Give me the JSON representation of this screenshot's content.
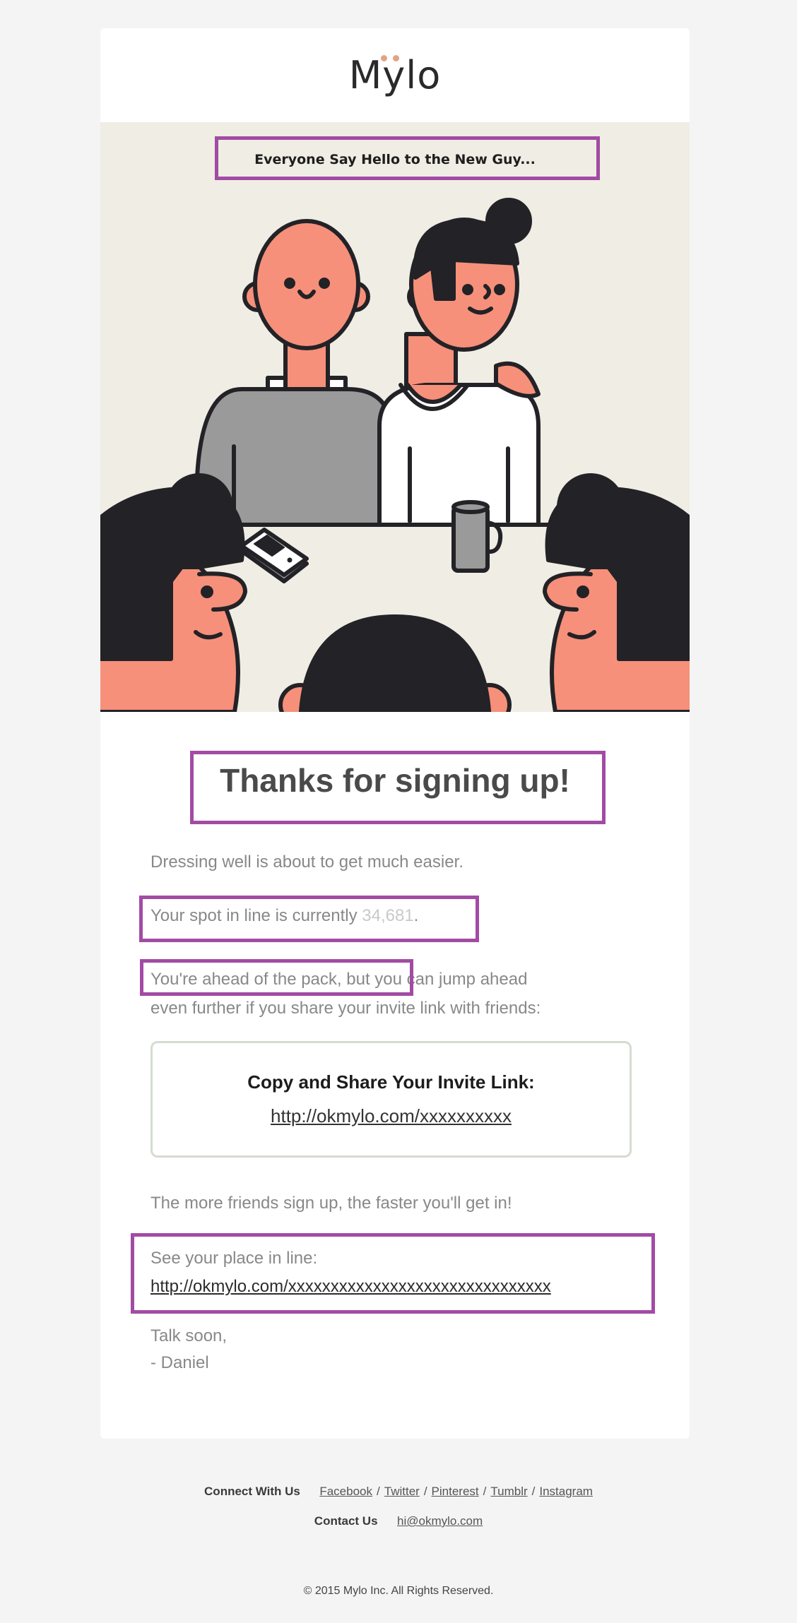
{
  "header": {
    "logo_text": "Mylo"
  },
  "hero": {
    "caption": "Everyone Say Hello to the New Guy...",
    "illustration": "team-meeting-illustration"
  },
  "main": {
    "title": "Thanks for signing up!",
    "intro": "Dressing well is about to get much easier.",
    "spot_prefix": "Your spot in line is currently ",
    "spot_number": "34,681",
    "spot_suffix": ".",
    "ahead_line1": "You're ahead of the pack, but you can jump ahead",
    "ahead_line2": "even further if you share your invite link with friends:",
    "invite_box": {
      "title": "Copy and Share Your Invite Link:",
      "link": "http://okmylo.com/xxxxxxxxxx"
    },
    "more_friends": "The more friends sign up, the faster you'll get in!",
    "place_label": "See your place in line:",
    "place_link": "http://okmylo.com/xxxxxxxxxxxxxxxxxxxxxxxxxxxxxxx",
    "signoff_1": "Talk soon,",
    "signoff_2": "- Daniel"
  },
  "footer": {
    "connect_label": "Connect With Us",
    "social_links": [
      "Facebook",
      "Twitter",
      "Pinterest",
      "Tumblr",
      "Instagram"
    ],
    "separator": "/",
    "contact_label": "Contact Us",
    "contact_email": "hi@okmylo.com",
    "copyright": "© 2015 Mylo Inc. All Rights Reserved."
  },
  "colors": {
    "highlight": "#a24ba4",
    "page_bg": "#f4f4f4",
    "hero_bg": "#efede4",
    "skin": "#f6907a",
    "hair": "#232226",
    "logo_dots": "#e0a486",
    "spot_number": "#c9c9c9"
  }
}
